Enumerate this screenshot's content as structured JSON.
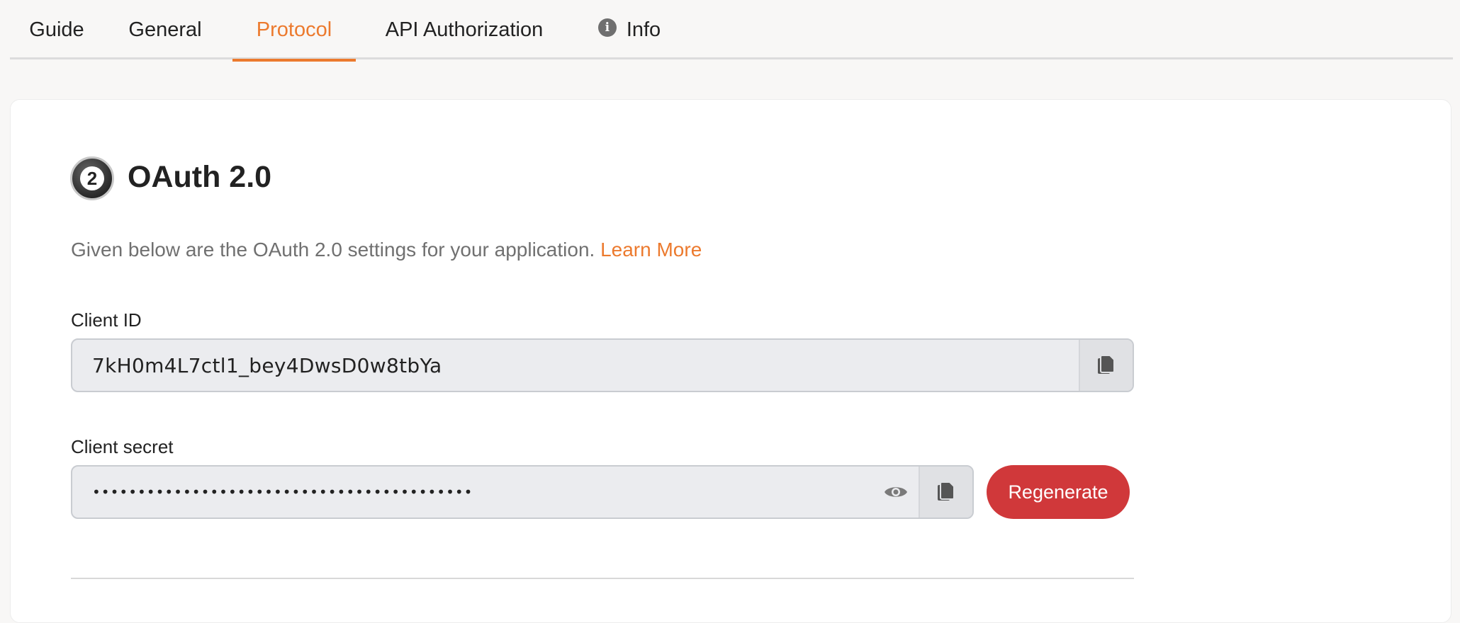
{
  "tabs": [
    {
      "label": "Guide",
      "active": false
    },
    {
      "label": "General",
      "active": false
    },
    {
      "label": "Protocol",
      "active": true
    },
    {
      "label": "API Authorization",
      "active": false
    },
    {
      "label": "Info",
      "active": false,
      "icon": "info-icon"
    }
  ],
  "section": {
    "logo_text": "2",
    "title": "OAuth 2.0",
    "description": "Given below are the OAuth 2.0 settings for your application.",
    "learn_more": "Learn More"
  },
  "client_id": {
    "label": "Client ID",
    "value": "7kH0m4L7ctl1_bey4DwsD0w8tbYa",
    "copy_icon": "copy-icon"
  },
  "client_secret": {
    "label": "Client secret",
    "masked_value": "••••••••••••••••••••••••••••••••••••••••••",
    "eye_icon": "eye-icon",
    "copy_icon": "copy-icon",
    "regenerate_label": "Regenerate"
  },
  "colors": {
    "accent": "#ec7a2e",
    "danger": "#d0383a",
    "field_bg": "#ebecef"
  }
}
